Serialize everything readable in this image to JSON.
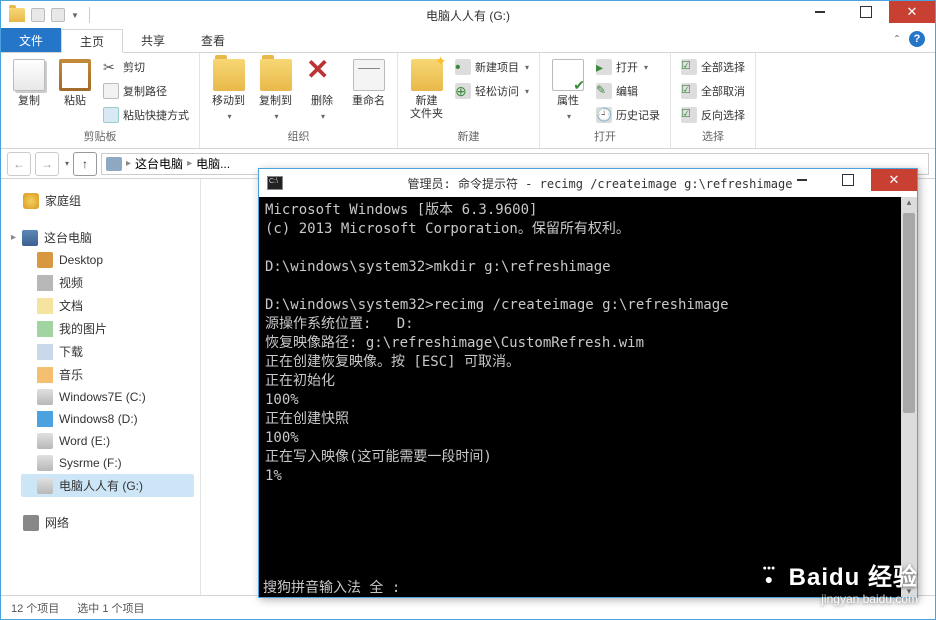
{
  "explorer": {
    "title": "电脑人人有 (G:)",
    "tabs": {
      "file": "文件",
      "home": "主页",
      "share": "共享",
      "view": "查看"
    },
    "ribbon": {
      "clipboard": {
        "label": "剪贴板",
        "copy": "复制",
        "paste": "粘贴",
        "cut": "剪切",
        "copyPath": "复制路径",
        "pasteShortcut": "粘贴快捷方式"
      },
      "organize": {
        "label": "组织",
        "moveTo": "移动到",
        "copyTo": "复制到",
        "delete": "删除",
        "rename": "重命名"
      },
      "new": {
        "label": "新建",
        "newFolder": "新建\n文件夹",
        "newItem": "新建项目",
        "easyAccess": "轻松访问"
      },
      "open": {
        "label": "打开",
        "properties": "属性",
        "open": "打开",
        "edit": "编辑",
        "history": "历史记录"
      },
      "select": {
        "label": "选择",
        "selectAll": "全部选择",
        "selectNone": "全部取消",
        "invertSelection": "反向选择"
      }
    },
    "breadcrumb": {
      "root": "这台电脑",
      "current": "电脑..."
    },
    "sidebar": {
      "homegroup": "家庭组",
      "thisPC": "这台电脑",
      "items": [
        "Desktop",
        "视频",
        "文档",
        "我的图片",
        "下载",
        "音乐",
        "Windows7E (C:)",
        "Windows8 (D:)",
        "Word (E:)",
        "Sysrme (F:)",
        "电脑人人有 (G:)"
      ],
      "network": "网络"
    },
    "status": {
      "items": "12 个项目",
      "selected": "选中 1 个项目"
    }
  },
  "cmd": {
    "title": "管理员: 命令提示符 - recimg  /createimage g:\\refreshimage",
    "lines": [
      "Microsoft Windows [版本 6.3.9600]",
      "(c) 2013 Microsoft Corporation。保留所有权利。",
      "",
      "D:\\windows\\system32>mkdir g:\\refreshimage",
      "",
      "D:\\windows\\system32>recimg /createimage g:\\refreshimage",
      "源操作系统位置:   D:",
      "恢复映像路径: g:\\refreshimage\\CustomRefresh.wim",
      "正在创建恢复映像。按 [ESC] 可取消。",
      "正在初始化",
      "100%",
      "正在创建快照",
      "100%",
      "正在写入映像(这可能需要一段时间)",
      "1%"
    ],
    "ime": "搜狗拼音输入法  全 :"
  },
  "watermark": {
    "brand": "Baidu 经验",
    "url": "jingyan.baidu.com"
  }
}
